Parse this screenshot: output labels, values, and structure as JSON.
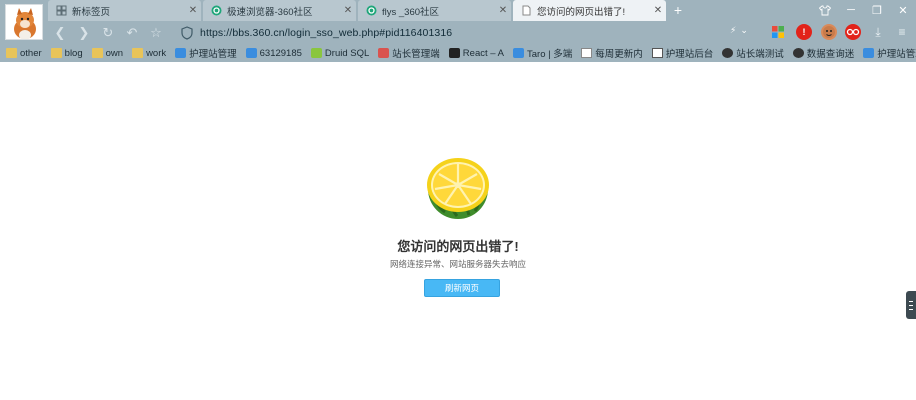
{
  "tabs": [
    {
      "title": "新标签页",
      "icon": "grid-icon"
    },
    {
      "title": "极速浏览器-360社区",
      "icon": "360-community-icon"
    },
    {
      "title": "flys _360社区",
      "icon": "360-community-icon"
    },
    {
      "title": "您访问的网页出错了!",
      "icon": "page-icon"
    }
  ],
  "address": {
    "url": "https://bbs.360.cn/login_sso_web.php#pid116401316"
  },
  "bookmarks": [
    {
      "label": "other",
      "icon": "folder-icon"
    },
    {
      "label": "blog",
      "icon": "folder-icon"
    },
    {
      "label": "own",
      "icon": "folder-icon"
    },
    {
      "label": "work",
      "icon": "folder-icon"
    },
    {
      "label": "护理站管理",
      "icon": "site-icon"
    },
    {
      "label": "63129185",
      "icon": "site-icon"
    },
    {
      "label": "Druid SQL",
      "icon": "druid-icon"
    },
    {
      "label": "站长管理端",
      "icon": "admin-icon"
    },
    {
      "label": "React – A",
      "icon": "react-icon"
    },
    {
      "label": "Taro | 多端",
      "icon": "taro-icon"
    },
    {
      "label": "每周更新内",
      "icon": "page-icon"
    },
    {
      "label": "护理站后台",
      "icon": "image-icon"
    },
    {
      "label": "站长端测试",
      "icon": "github-icon"
    },
    {
      "label": "数据查询迷",
      "icon": "github-icon"
    },
    {
      "label": "护理站管理",
      "icon": "site-icon"
    }
  ],
  "error": {
    "title": "您访问的网页出错了!",
    "subtitle": "网络连接异常、网站服务器失去响应",
    "refresh_label": "刷新网页"
  },
  "colors": {
    "chrome": "#9fb3bd",
    "active_tab": "#eef2f5",
    "button": "#48b8f5"
  }
}
